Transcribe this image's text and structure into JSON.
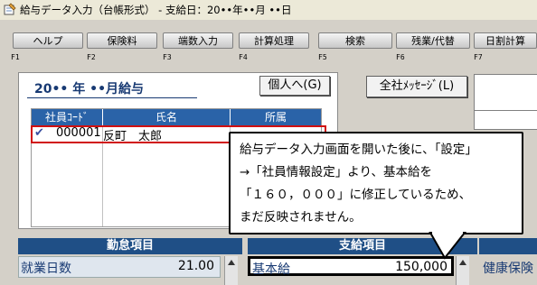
{
  "window": {
    "title": "給与データ入力（台帳形式） - 支給日：20••年••月 ••日"
  },
  "fkeys": [
    {
      "label": "ヘルプ",
      "key": "F1"
    },
    {
      "label": "保険料",
      "key": "F2"
    },
    {
      "label": "端数入力",
      "key": "F3"
    },
    {
      "label": "計算処理",
      "key": "F4"
    },
    {
      "label": "検索",
      "key": "F5"
    },
    {
      "label": "残業/代替",
      "key": "F6"
    },
    {
      "label": "日割計算",
      "key": "F7"
    }
  ],
  "header": {
    "period": "20•• 年 ••月給与",
    "personal_button": "個人へ(G)",
    "company_message_button": "全社ﾒｯｾｰｼﾞ(L)"
  },
  "employee_grid": {
    "columns": [
      "社員ｺｰﾄﾞ",
      "氏名",
      "所属"
    ],
    "rows": [
      {
        "check": "✔",
        "code": "000001",
        "name": "反町　太郎",
        "dept": ""
      }
    ]
  },
  "callout": {
    "lines": [
      "給与データ入力画面を開いた後に、「設定」",
      "→「社員情報設定」より、基本給を",
      "「１６０，０００」に修正しているため、",
      "まだ反映されません。"
    ]
  },
  "sections": {
    "attendance": {
      "title": "勤怠項目",
      "items": [
        {
          "label": "就業日数",
          "value": "21.00"
        }
      ]
    },
    "payment": {
      "title": "支給項目",
      "items": [
        {
          "label": "基本給",
          "value": "150,000"
        }
      ]
    },
    "deduction_partial": "健康保険"
  }
}
